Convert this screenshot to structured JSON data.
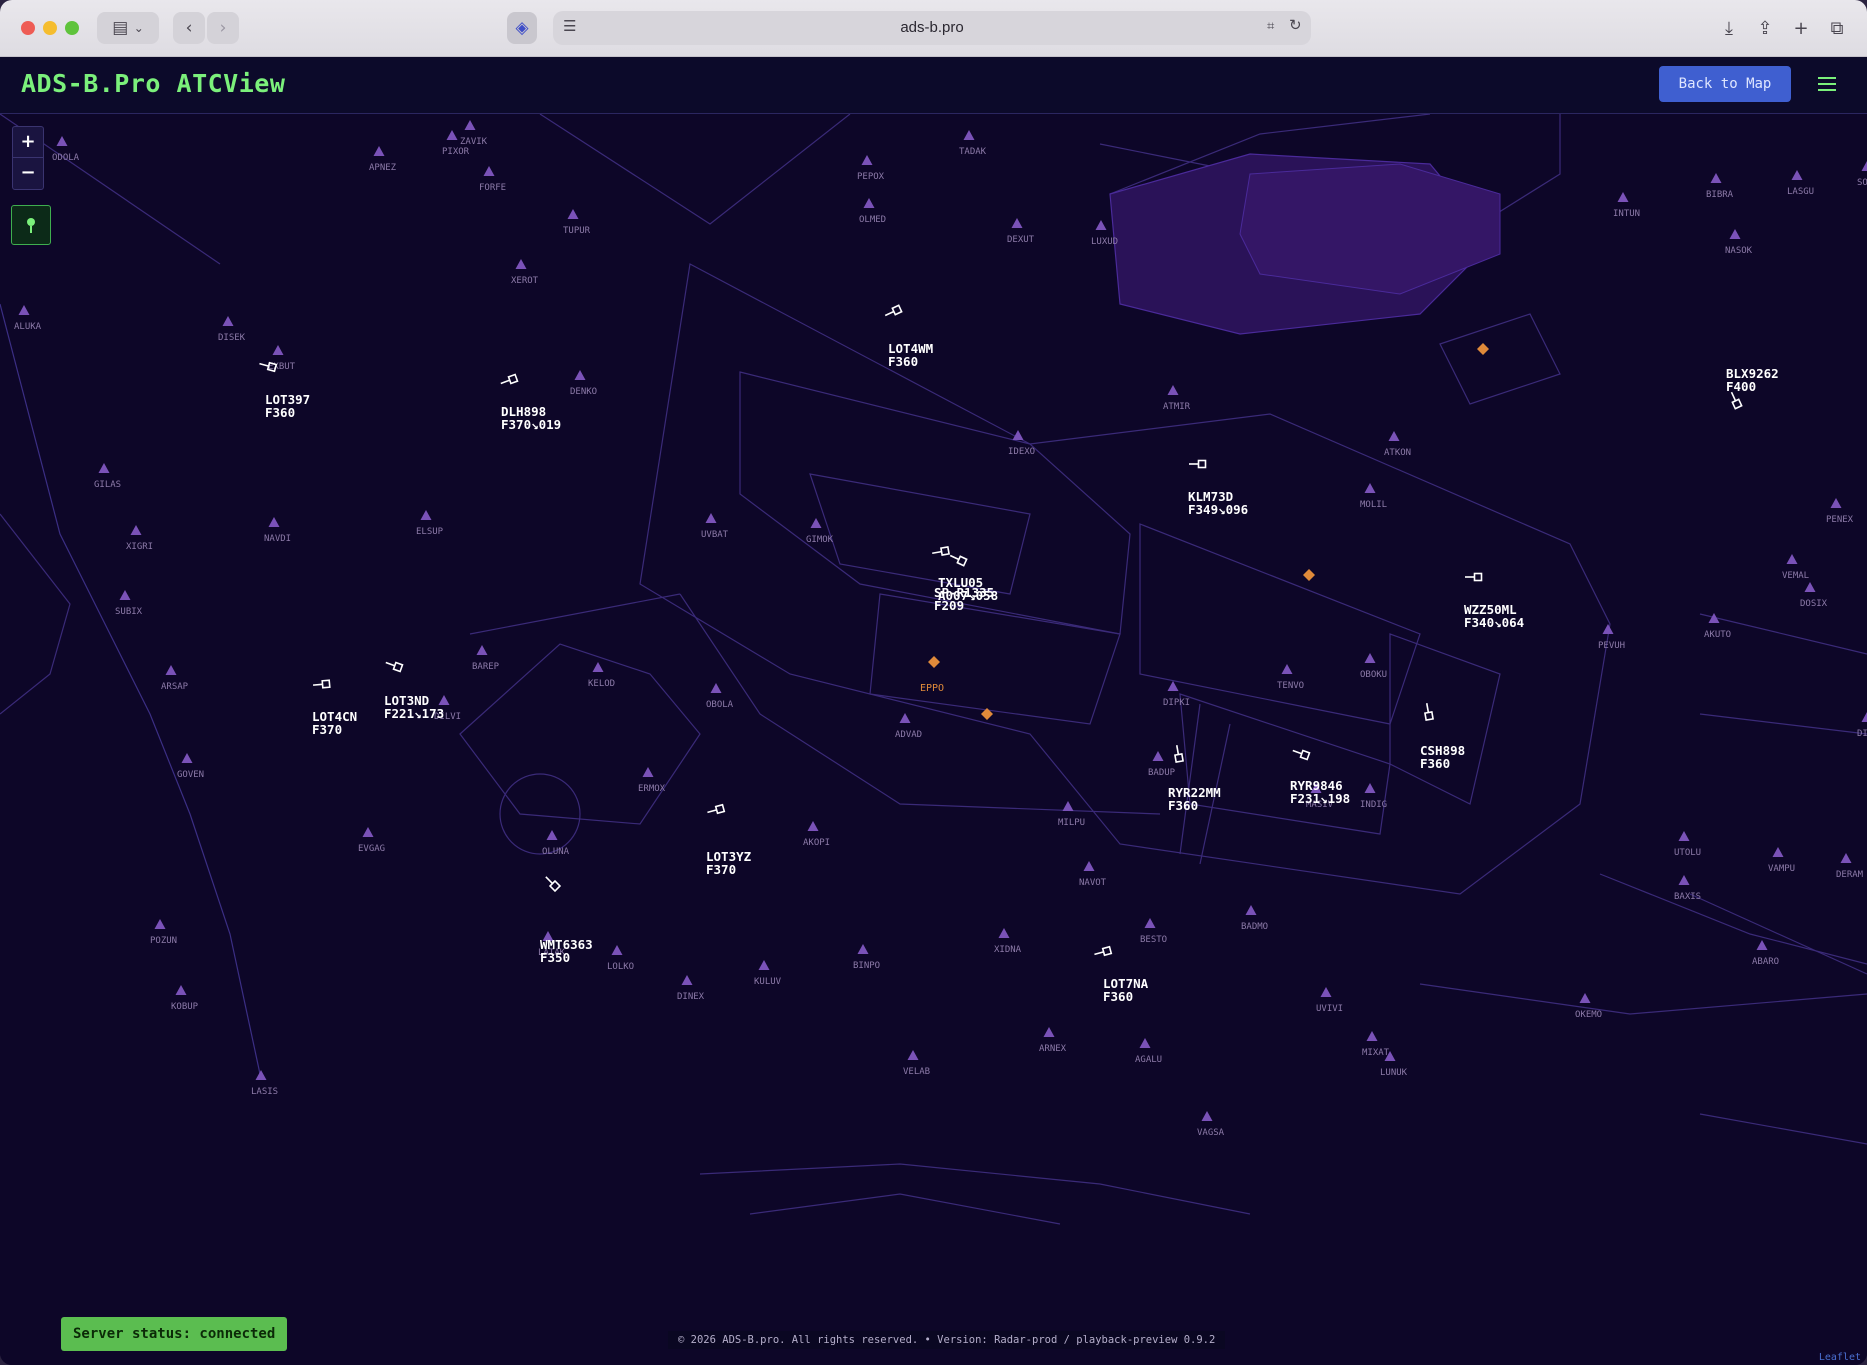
{
  "browser": {
    "url": "ads-b.pro",
    "traffic_lights": [
      "close",
      "minimize",
      "zoom"
    ]
  },
  "app": {
    "title": "ADS-B.Pro ATCView",
    "back_button": "Back to Map"
  },
  "map": {
    "zoom_in": "+",
    "zoom_out": "−",
    "status": "Server status: connected",
    "footer": "© 2026 ADS-B.pro. All rights reserved. • Version: Radar-prod / playback-preview 0.9.2",
    "attribution": "Leaflet",
    "airport_label": "EPPO",
    "colors": {
      "background": "#0d0628",
      "sector_lines": "#3a2a78",
      "fix_marker": "#7a52b8",
      "aircraft": "#ffffff",
      "airport": "#e08a3a",
      "accent": "#7bf07b"
    },
    "fixes": [
      "ODOLA",
      "ZAVIK",
      "APNEZ",
      "PIXOR",
      "FORFE",
      "TUPUR",
      "XEROT",
      "PEPOX",
      "OLMED",
      "TADAK",
      "DEXUT",
      "LUXUD",
      "INTUN",
      "BIBRA",
      "LASGU",
      "SOMOX",
      "NASOK",
      "ALUKA",
      "DISEK",
      "EXBUT",
      "DENKO",
      "ATMIR",
      "IDEXO",
      "ATKON",
      "MOLIL",
      "GILAS",
      "XIGRI",
      "NAVDI",
      "ELSUP",
      "UVBAT",
      "GIMOK",
      "PENEX",
      "VEMAL",
      "DOSIX",
      "AKUTO",
      "PEVUH",
      "SUBIX",
      "ARSAP",
      "BAREP",
      "KELOD",
      "OBOLA",
      "DILVI",
      "ADVAD",
      "DIPKI",
      "TENVO",
      "OBOKU",
      "GOVEN",
      "BADUP",
      "MASIV",
      "INDIG",
      "DIBLO",
      "ERMOX",
      "MILPU",
      "EVGAG",
      "OLUNA",
      "AKOPI",
      "NAVOT",
      "UTOLU",
      "VAMPU",
      "DERAM",
      "BAXIS",
      "POZUN",
      "LATAK",
      "LOLKO",
      "DINEX",
      "KULUV",
      "BINPO",
      "XIDNA",
      "BESTO",
      "BADMO",
      "ABARO",
      "KOBUP",
      "UVIVI",
      "OKEMO",
      "ARNEX",
      "AGALU",
      "VELAB",
      "MIXAT",
      "LUNUK",
      "LASIS",
      "VAGSA"
    ],
    "aircraft": [
      {
        "callsign": "LOT4WM",
        "level": "F360"
      },
      {
        "callsign": "LOT397",
        "level": "F360"
      },
      {
        "callsign": "DLH898",
        "level": "F370↘019"
      },
      {
        "callsign": "BLX9262",
        "level": "F400"
      },
      {
        "callsign": "KLM73D",
        "level": "F349↘096"
      },
      {
        "callsign": "TXLU05",
        "level": "A007↘058"
      },
      {
        "callsign": "SP-R1335",
        "level": "F209"
      },
      {
        "callsign": "WZZ50ML",
        "level": "F340↘064"
      },
      {
        "callsign": "LOT3ND",
        "level": "F221↘173"
      },
      {
        "callsign": "LOT4CN",
        "level": "F370"
      },
      {
        "callsign": "CSH898",
        "level": "F360"
      },
      {
        "callsign": "RYR22MM",
        "level": "F360"
      },
      {
        "callsign": "RYR9846",
        "level": "F231↘198"
      },
      {
        "callsign": "LOT3YZ",
        "level": "F370"
      },
      {
        "callsign": "WMT6363",
        "level": "F350"
      },
      {
        "callsign": "LOT7NA",
        "level": "F360"
      }
    ]
  }
}
